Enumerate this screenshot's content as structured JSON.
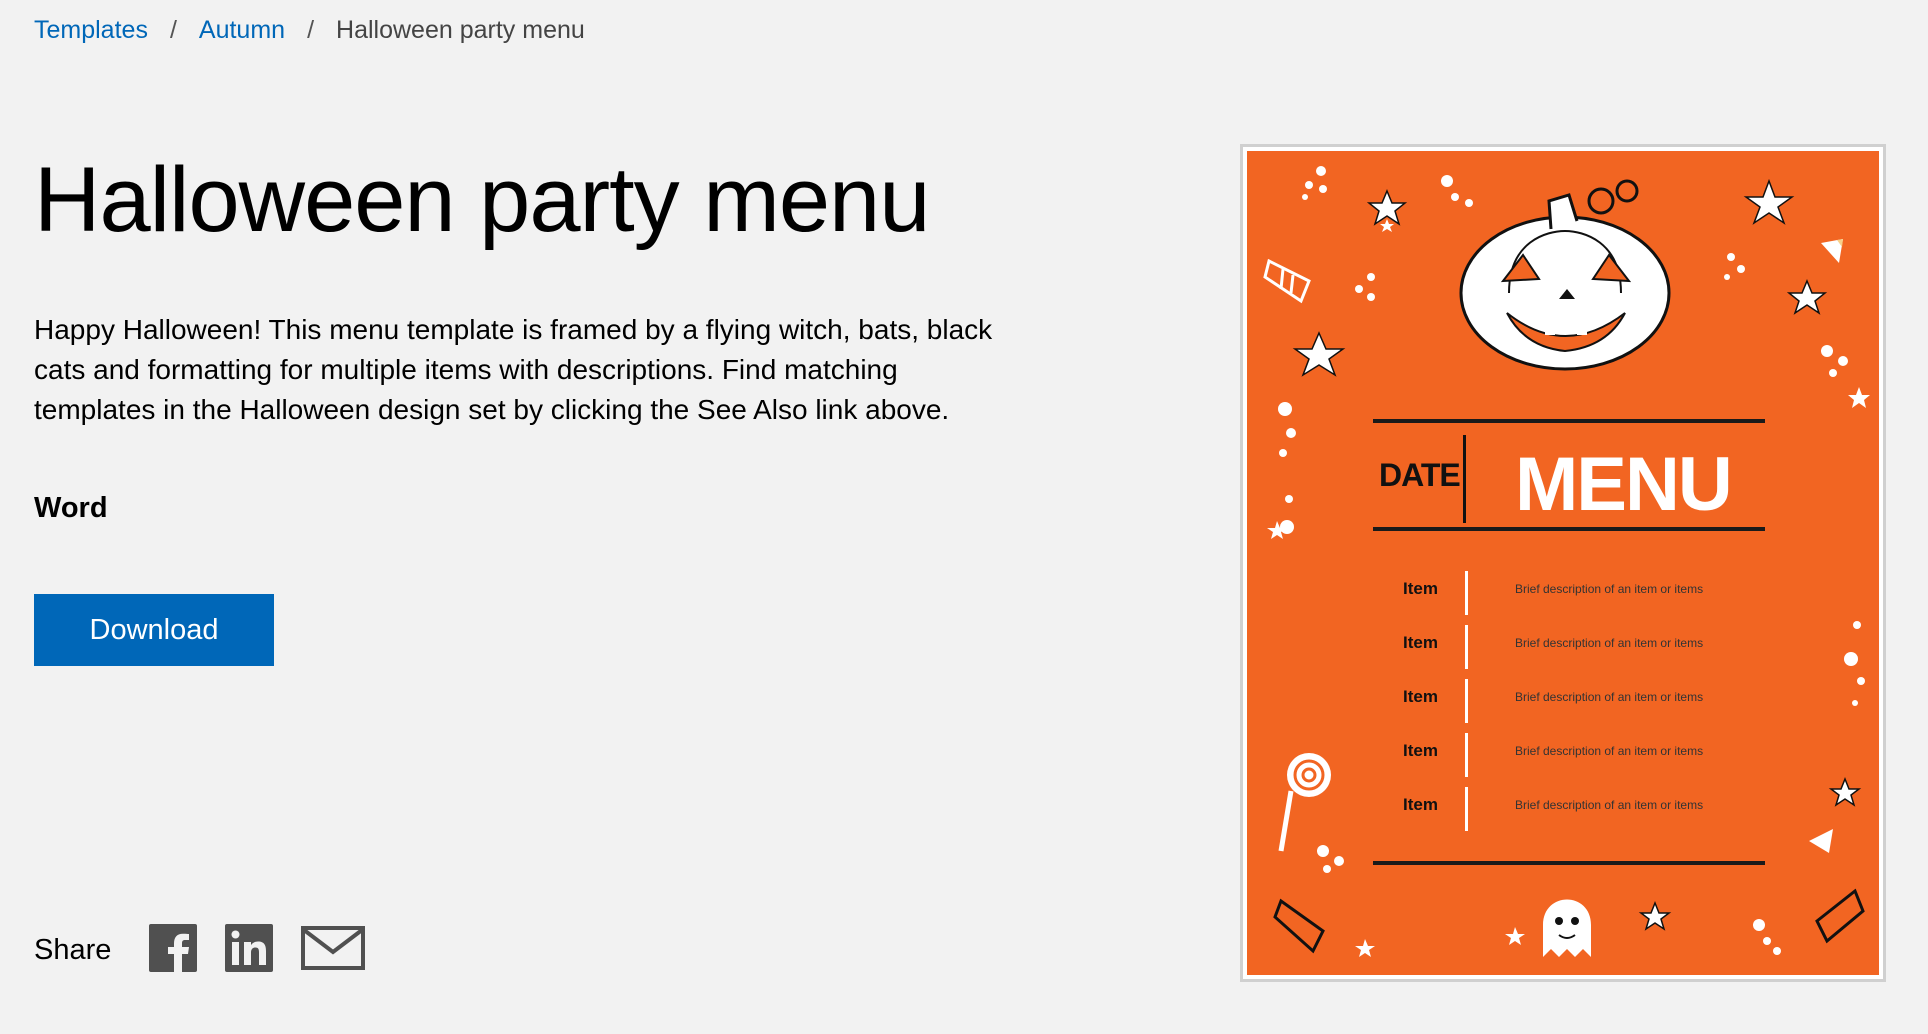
{
  "breadcrumb": {
    "items": [
      {
        "label": "Templates"
      },
      {
        "label": "Autumn"
      }
    ],
    "separator": "/",
    "current": "Halloween party menu"
  },
  "title": "Halloween party menu",
  "description": "Happy Halloween! This menu template is framed by a flying witch, bats, black cats and formatting for multiple items with descriptions. Find matching templates in the Halloween design set by clicking the See Also link above.",
  "app_name": "Word",
  "download_label": "Download",
  "share": {
    "label": "Share",
    "icons": [
      "facebook-icon",
      "linkedin-icon",
      "email-icon"
    ]
  },
  "preview": {
    "date": "DATE",
    "heading": "MENU",
    "rows": [
      {
        "item": "Item",
        "desc": "Brief description of an item or items"
      },
      {
        "item": "Item",
        "desc": "Brief description of an item or items"
      },
      {
        "item": "Item",
        "desc": "Brief description of an item or items"
      },
      {
        "item": "Item",
        "desc": "Brief description of an item or items"
      },
      {
        "item": "Item",
        "desc": "Brief description of an item or items"
      }
    ],
    "colors": {
      "background": "#f26522",
      "ink": "#111111"
    }
  },
  "colors": {
    "accent": "#0067b8",
    "page": "#f2f2f2"
  }
}
